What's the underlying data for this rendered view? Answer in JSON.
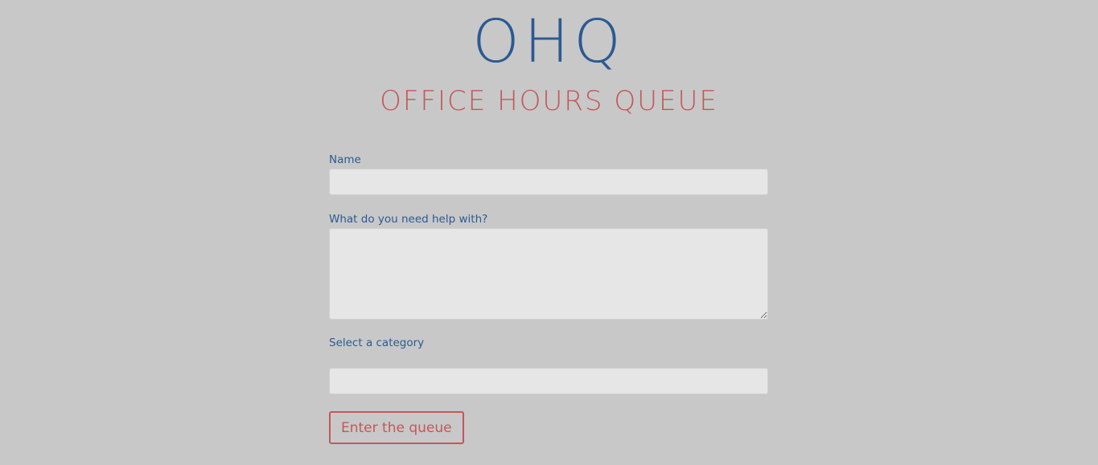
{
  "header": {
    "logo": "OHQ",
    "subtitle": "OFFICE HOURS QUEUE"
  },
  "form": {
    "name_label": "Name",
    "name_value": "",
    "help_label": "What do you need help with?",
    "help_value": "",
    "category_label": "Select a category",
    "category_value": "",
    "submit_label": "Enter the queue"
  },
  "colors": {
    "background": "#c8c8c8",
    "primary_blue": "#2b5a93",
    "accent_red": "#c4575a",
    "field_bg": "#e6e6e6"
  }
}
